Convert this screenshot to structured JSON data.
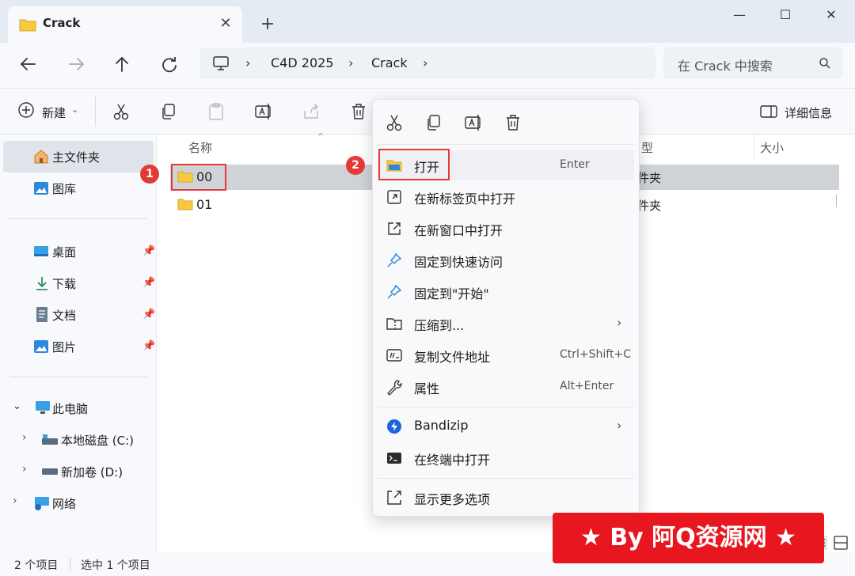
{
  "window": {
    "tab_title": "Crack",
    "tab_close": "✕",
    "new_tab": "+",
    "minimize": "—",
    "maximize": "☐",
    "close": "✕"
  },
  "nav": {
    "breadcrumb": [
      "C4D 2025",
      "Crack"
    ],
    "search_placeholder": "在 Crack 中搜索"
  },
  "commandbar": {
    "new_label": "新建",
    "details_label": "详细信息"
  },
  "sidebar": {
    "home": "主文件夹",
    "gallery": "图库",
    "desktop": "桌面",
    "downloads": "下载",
    "documents": "文档",
    "pictures": "图片",
    "this_pc": "此电脑",
    "drive_c": "本地磁盘 (C:)",
    "drive_d": "新加卷 (D:)",
    "network": "网络"
  },
  "filelist": {
    "col_name": "名称",
    "col_type_partial": "型",
    "col_size": "大小",
    "rows": [
      {
        "name": "00",
        "type_partial": "件夹"
      },
      {
        "name": "01",
        "type_partial": "件夹"
      }
    ]
  },
  "status": {
    "count": "2 个项目",
    "selected": "选中 1 个项目"
  },
  "context_menu": {
    "items": [
      {
        "label": "打开",
        "shortcut": "Enter",
        "icon": "folder-open-icon"
      },
      {
        "label": "在新标签页中打开",
        "shortcut": "",
        "icon": "new-tab-icon"
      },
      {
        "label": "在新窗口中打开",
        "shortcut": "",
        "icon": "new-window-icon"
      },
      {
        "label": "固定到快速访问",
        "shortcut": "",
        "icon": "pin-icon"
      },
      {
        "label": "固定到\"开始\"",
        "shortcut": "",
        "icon": "pin-icon"
      },
      {
        "label": "压缩到...",
        "shortcut": "",
        "icon": "zip-icon"
      },
      {
        "label": "复制文件地址",
        "shortcut": "Ctrl+Shift+C",
        "icon": "copy-path-icon"
      },
      {
        "label": "属性",
        "shortcut": "Alt+Enter",
        "icon": "wrench-icon"
      },
      {
        "label": "Bandizip",
        "shortcut": "",
        "icon": "bandizip-icon"
      },
      {
        "label": "在终端中打开",
        "shortcut": "",
        "icon": "terminal-icon"
      },
      {
        "label": "显示更多选项",
        "shortcut": "",
        "icon": "more-options-icon"
      }
    ]
  },
  "annotations": {
    "badge1": "1",
    "badge2": "2",
    "watermark": "★ By 阿Q资源网 ★"
  },
  "colors": {
    "accent": "#0067c0",
    "folder": "#f8c940",
    "annotation_red": "#e53935",
    "watermark_red": "#e8161f"
  }
}
